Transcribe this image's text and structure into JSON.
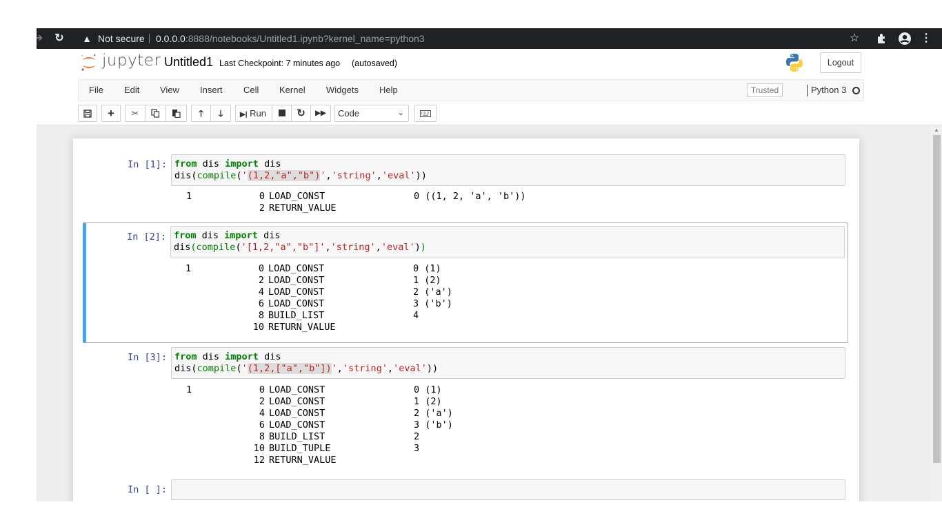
{
  "browser": {
    "security_label": "Not secure",
    "url_host": "0.0.0.0",
    "url_rest": ":8888/notebooks/Untitled1.ipynb?kernel_name=python3",
    "icons": {
      "forward": "arrow-right-icon",
      "reload": "reload-icon",
      "warning": "warning-icon",
      "bookmark": "star-icon",
      "extensions": "puzzle-icon",
      "profile": "account-icon",
      "menu": "kebab-menu-icon"
    }
  },
  "header": {
    "logo_text": "jupyter",
    "notebook_name": "Untitled1",
    "checkpoint": "Last Checkpoint: 7 minutes ago",
    "autosave_status": "(autosaved)",
    "logout_label": "Logout"
  },
  "menubar": {
    "items": [
      "File",
      "Edit",
      "View",
      "Insert",
      "Cell",
      "Kernel",
      "Widgets",
      "Help"
    ],
    "trusted_label": "Trusted",
    "kernel_name": "Python 3",
    "kernel_status": "idle"
  },
  "toolbar": {
    "run_label": "Run",
    "cell_type": "Code",
    "buttons": [
      "save",
      "insert-cell-below",
      "cut",
      "copy",
      "paste",
      "move-up",
      "move-down",
      "run",
      "interrupt",
      "restart",
      "restart-run-all",
      "command-palette"
    ]
  },
  "cells": [
    {
      "prompt": "In [1]:",
      "code_line1": [
        "from",
        " dis ",
        "import",
        " dis"
      ],
      "code_line2": {
        "pre": "dis",
        "open": "(",
        "compile": "compile",
        "p2": "(",
        "q1": "'",
        "str_hl": "(1,2,\"a\",\"b\")",
        "q2": "'",
        "comma1": ",",
        "arg2": "'string'",
        "comma2": ",",
        "arg3": "'eval'",
        "close": "))"
      },
      "output": [
        {
          "line": "1",
          "offset": "0",
          "op": "LOAD_CONST",
          "arg": "0 ((1, 2, 'a', 'b'))"
        },
        {
          "line": "",
          "offset": "2",
          "op": "RETURN_VALUE",
          "arg": ""
        }
      ]
    },
    {
      "prompt": "In [2]:",
      "selected": true,
      "code_line1": [
        "from",
        " dis ",
        "import",
        " dis"
      ],
      "code_line2": {
        "pre": "dis",
        "open": "(",
        "compile": "compile",
        "p2": "(",
        "str_full": "'[1,2,\"a\",\"b\"]'",
        "comma1": ",",
        "arg2": "'string'",
        "comma2": ",",
        "arg3": "'eval'",
        "close1": ")",
        "close2": ")"
      },
      "output": [
        {
          "line": "1",
          "offset": "0",
          "op": "LOAD_CONST",
          "arg": "0 (1)"
        },
        {
          "line": "",
          "offset": "2",
          "op": "LOAD_CONST",
          "arg": "1 (2)"
        },
        {
          "line": "",
          "offset": "4",
          "op": "LOAD_CONST",
          "arg": "2 ('a')"
        },
        {
          "line": "",
          "offset": "6",
          "op": "LOAD_CONST",
          "arg": "3 ('b')"
        },
        {
          "line": "",
          "offset": "8",
          "op": "BUILD_LIST",
          "arg": "4"
        },
        {
          "line": "",
          "offset": "10",
          "op": "RETURN_VALUE",
          "arg": ""
        }
      ]
    },
    {
      "prompt": "In [3]:",
      "code_line1": [
        "from",
        " dis ",
        "import",
        " dis"
      ],
      "code_line2": {
        "pre": "dis",
        "open": "(",
        "compile": "compile",
        "p2": "(",
        "q1": "'",
        "str_hl": "(1,2,[\"a\",\"b\"])",
        "q2": "'",
        "comma1": ",",
        "arg2": "'string'",
        "comma2": ",",
        "arg3": "'eval'",
        "close": "))"
      },
      "output": [
        {
          "line": "1",
          "offset": "0",
          "op": "LOAD_CONST",
          "arg": "0 (1)"
        },
        {
          "line": "",
          "offset": "2",
          "op": "LOAD_CONST",
          "arg": "1 (2)"
        },
        {
          "line": "",
          "offset": "4",
          "op": "LOAD_CONST",
          "arg": "2 ('a')"
        },
        {
          "line": "",
          "offset": "6",
          "op": "LOAD_CONST",
          "arg": "3 ('b')"
        },
        {
          "line": "",
          "offset": "8",
          "op": "BUILD_LIST",
          "arg": "2"
        },
        {
          "line": "",
          "offset": "10",
          "op": "BUILD_TUPLE",
          "arg": "3"
        },
        {
          "line": "",
          "offset": "12",
          "op": "RETURN_VALUE",
          "arg": ""
        }
      ]
    },
    {
      "prompt": "In [ ]:",
      "code": ""
    }
  ],
  "colors": {
    "selected_cell_bar": "#42a5f5",
    "keyword": "#008000",
    "string": "#ba2121",
    "prompt": "#303f9f"
  }
}
